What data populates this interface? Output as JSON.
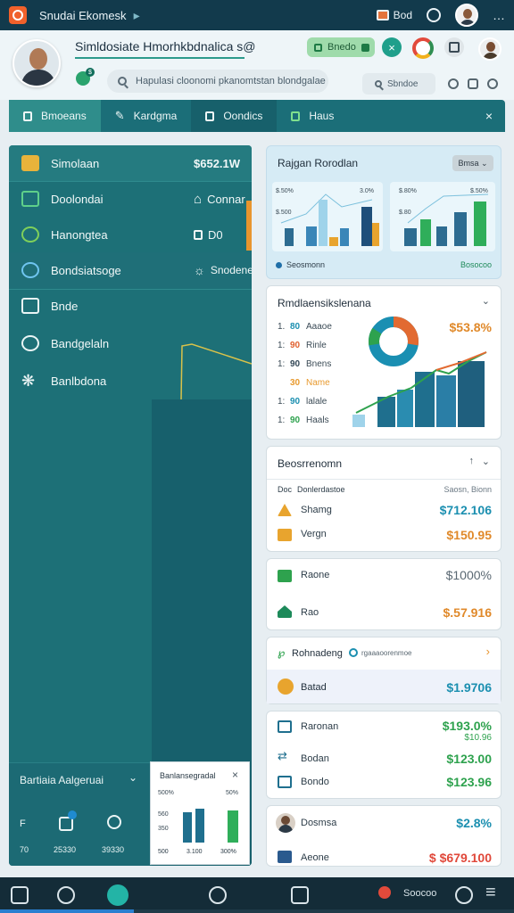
{
  "app": {
    "title": "Snudai Ekomesk",
    "wallet_label": "Bod"
  },
  "header": {
    "title": "Simldosiate Hmorhkbdnalica s@",
    "status_badge": "$",
    "search_placeholder": "Hapulasi cloonomi pkanomtstan blondgalae",
    "secondary_search": "Sbndoe",
    "pill_label": "Bnedo"
  },
  "tabs": [
    {
      "label": "Bmoeans"
    },
    {
      "label": "Kardgma"
    },
    {
      "label": "Oondics"
    },
    {
      "label": "Haus"
    }
  ],
  "sidebar": {
    "items": [
      {
        "label": "Simolaan",
        "value": "$652.1W"
      },
      {
        "label": "Doolondai",
        "value": "Connar"
      },
      {
        "label": "Hanongtea",
        "value": "D0"
      },
      {
        "label": "Bondsiatsoge",
        "value": "Snodene"
      },
      {
        "label": "Bnde"
      },
      {
        "label": "Bandgelaln"
      },
      {
        "label": "Banlbdona"
      }
    ],
    "bottom": {
      "label": "Bartiaia Aalgeruai",
      "values": [
        "70",
        "25330",
        "39330"
      ],
      "left_letter": "F"
    },
    "mini_chart": {
      "title": "Banlansegradal",
      "labels": [
        "500%",
        "50%",
        "560",
        "350",
        "500",
        "350"
      ],
      "x_labels": [
        "500",
        "3.100",
        "300%"
      ]
    }
  },
  "cards": {
    "overview": {
      "title": "Rajgan Rorodlan",
      "button": "Bmsa",
      "footer_left": "Seosmonn",
      "footer_right": "Bosocoo",
      "left_axis": [
        "$.50%",
        "$.500"
      ],
      "left_axis2": [
        "3.0%",
        "$.80%",
        "$.80"
      ],
      "right_axis": [
        "$.50%"
      ]
    },
    "performance": {
      "title": "Rmdlaensikslenana",
      "rows": [
        {
          "num": "80",
          "label": "Aaaoe",
          "color": "#1b8fb0"
        },
        {
          "num": "90",
          "label": "Rinle",
          "color": "#e0612f"
        },
        {
          "num": "90",
          "label": "Bnens",
          "color": "#334756"
        },
        {
          "num": "30",
          "label": "Name",
          "color": "#e89a2e"
        },
        {
          "num": "90",
          "label": "lalale",
          "color": "#1b8fb0"
        },
        {
          "num": "90",
          "label": "Haals",
          "color": "#2ea24e"
        }
      ],
      "row_prefix": [
        "1.",
        "1:",
        "1:",
        "",
        "1:",
        "1:"
      ],
      "headline": "$53.8%"
    },
    "economy": {
      "title": "Beosrrenomn",
      "col1": "Doc",
      "col2": "Donlerdastoe",
      "col3": "Saosn, Bionn",
      "rows": [
        {
          "label": "Shamg",
          "value": "$712.106",
          "color": "#1b8fb0"
        },
        {
          "label": "Vergn",
          "value": "$150.95",
          "color": "#e0892a"
        }
      ]
    },
    "trade": {
      "rows": [
        {
          "label": "Raone",
          "value": "$1000%"
        },
        {
          "label": "Rao",
          "value": "$.57.916"
        }
      ]
    },
    "ranking": {
      "title": "Rohnadeng",
      "sub": "rgaaaoorenmoe",
      "row_label": "Batad",
      "row_value": "$1.9706"
    },
    "finance": {
      "rows": [
        {
          "label": "Raronan",
          "value": "$193.0%",
          "sub": "$10.96"
        },
        {
          "label": "Bodan",
          "value": "$123.00"
        },
        {
          "label": "Bondo",
          "value": "$123.96"
        }
      ]
    },
    "last": {
      "row1_label": "Dosmsa",
      "row1_value": "$2.8%",
      "row2_label": "Aeone",
      "row2_value": "$ $679.100"
    }
  },
  "bottom_nav": {
    "label": "Soocoo"
  }
}
